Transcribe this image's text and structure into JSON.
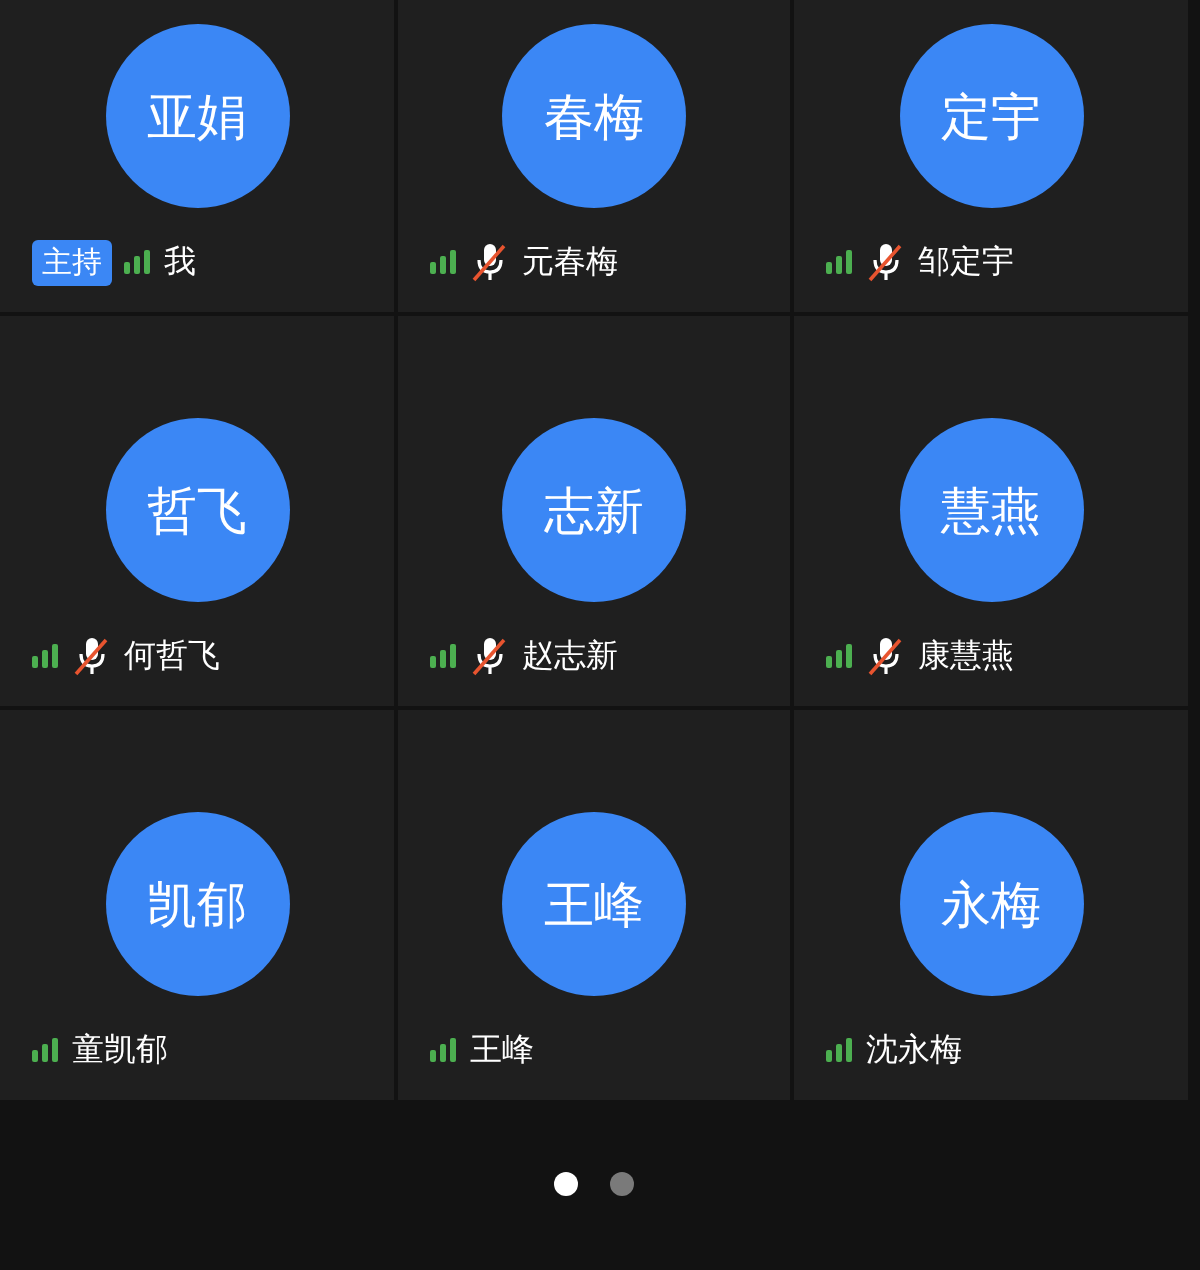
{
  "participants": [
    {
      "avatar": "亚娟",
      "name": "我",
      "host": true,
      "host_label": "主持",
      "muted": false
    },
    {
      "avatar": "春梅",
      "name": "元春梅",
      "host": false,
      "muted": true
    },
    {
      "avatar": "定宇",
      "name": "邹定宇",
      "host": false,
      "muted": true
    },
    {
      "avatar": "哲飞",
      "name": "何哲飞",
      "host": false,
      "muted": true
    },
    {
      "avatar": "志新",
      "name": "赵志新",
      "host": false,
      "muted": true
    },
    {
      "avatar": "慧燕",
      "name": "康慧燕",
      "host": false,
      "muted": true
    },
    {
      "avatar": "凯郁",
      "name": "童凯郁",
      "host": false,
      "muted": false
    },
    {
      "avatar": "王峰",
      "name": "王峰",
      "host": false,
      "muted": false
    },
    {
      "avatar": "永梅",
      "name": "沈永梅",
      "host": false,
      "muted": false
    }
  ],
  "pages": [
    {
      "selected": true
    },
    {
      "selected": false
    }
  ]
}
